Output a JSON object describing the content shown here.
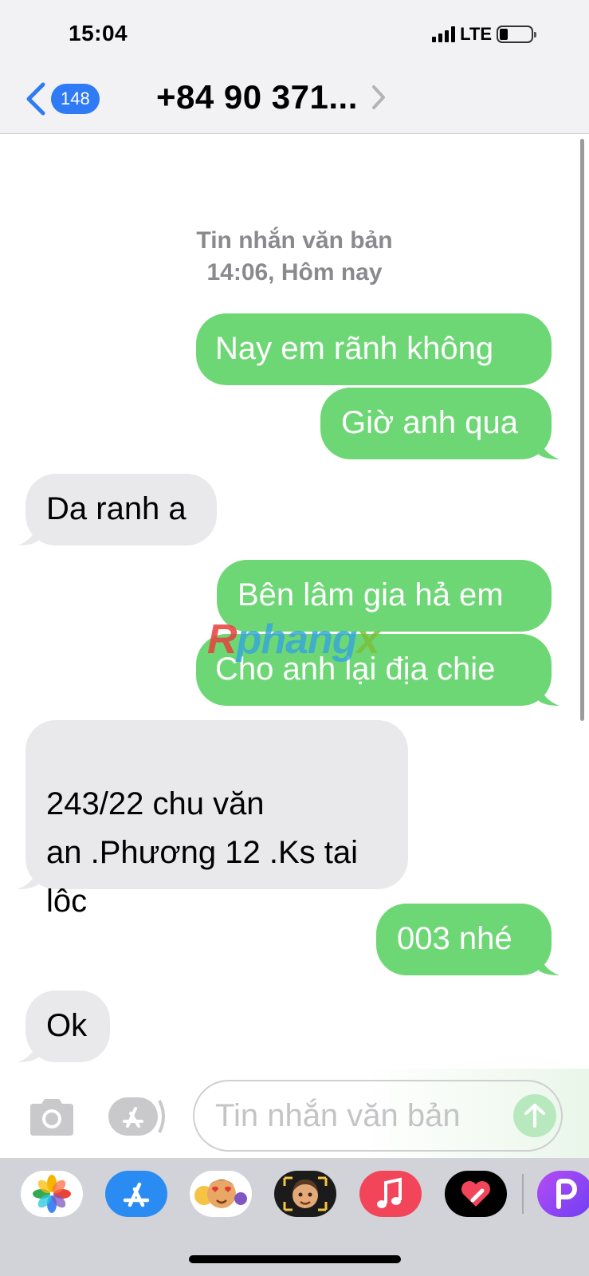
{
  "status_bar": {
    "time": "15:04",
    "network": "LTE",
    "battery_level": 0.2
  },
  "header": {
    "back_count": "148",
    "contact": "+84 90 371..."
  },
  "thread": {
    "timestamp_line1": "Tin nhắn văn bản",
    "timestamp_line2": "14:06, Hôm nay",
    "messages": [
      {
        "from": "me",
        "text": "Nay em rãnh không"
      },
      {
        "from": "me",
        "text": "Giờ anh qua"
      },
      {
        "from": "them",
        "text": "Da ranh a"
      },
      {
        "from": "me",
        "text": "Bên lâm gia hả em"
      },
      {
        "from": "me",
        "text": "Cho anh lại địa chie"
      },
      {
        "from": "them",
        "text": "243/22 chu văn\nan .Phương 12 .Ks tai\nlôc"
      },
      {
        "from": "me",
        "text": "003 nhé"
      },
      {
        "from": "them",
        "text": "Ok"
      }
    ]
  },
  "watermark": {
    "part1": "R",
    "part2": "phang",
    "part3": "x"
  },
  "compose": {
    "placeholder": "Tin nhắn văn bản"
  },
  "app_drawer": {
    "apps": [
      "photos-app",
      "app-store",
      "memoji-stickers",
      "animoji",
      "music",
      "digital-touch",
      "picsart"
    ]
  },
  "colors": {
    "sent_bubble": "#6ed775",
    "received_bubble": "#e9e9eb",
    "accent": "#2f7bf5"
  }
}
